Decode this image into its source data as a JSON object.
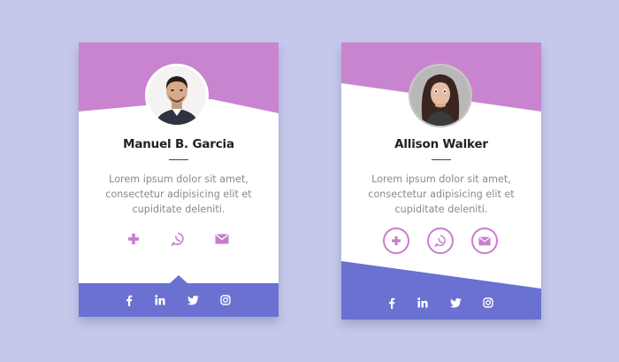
{
  "colors": {
    "background": "#c5c8ea",
    "header_purple": "#c984cf",
    "footer_blue": "#6a71d0",
    "icon_purple": "#c97dcd"
  },
  "cards": [
    {
      "name": "Manuel B. Garcia",
      "description": "Lorem ipsum dolor sit amet, consectetur adipisicing elit et cupiditate deleniti.",
      "contact_icons": [
        "plus-icon",
        "whatsapp-icon",
        "envelope-icon"
      ],
      "social_icons": [
        "facebook-icon",
        "linkedin-icon",
        "twitter-icon",
        "instagram-icon"
      ]
    },
    {
      "name": "Allison Walker",
      "description": "Lorem ipsum dolor sit amet, consectetur adipisicing elit et cupiditate deleniti.",
      "contact_icons": [
        "plus-icon",
        "whatsapp-icon",
        "envelope-icon"
      ],
      "social_icons": [
        "facebook-icon",
        "linkedin-icon",
        "twitter-icon",
        "instagram-icon"
      ]
    }
  ]
}
